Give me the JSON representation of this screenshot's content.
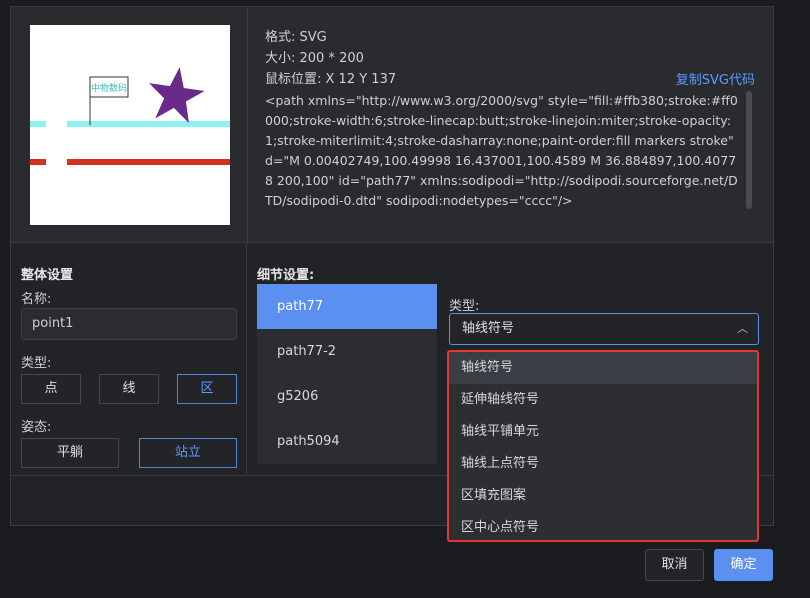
{
  "preview": {
    "flag_text": "中物数码",
    "colors": {
      "cyan_line": "#8ef2f2",
      "red_line": "#d2321f",
      "star": "#6a2a8a"
    }
  },
  "info": {
    "format": "格式: SVG",
    "size": "大小: 200 * 200",
    "mouse": "鼠标位置: X 12 Y 137",
    "copy_label": "复制SVG代码",
    "code": "<path xmlns=\"http://www.w3.org/2000/svg\" style=\"fill:#ffb380;stroke:#ff0000;stroke-width:6;stroke-linecap:butt;stroke-linejoin:miter;stroke-opacity:1;stroke-miterlimit:4;stroke-dasharray:none;paint-order:fill markers stroke\" d=\"M 0.00402749,100.49998 16.437001,100.4589 M 36.884897,100.40778 200,100\" id=\"path77\" xmlns:sodipodi=\"http://sodipodi.sourceforge.net/DTD/sodipodi-0.dtd\" sodipodi:nodetypes=\"cccc\"/>"
  },
  "overall": {
    "title": "整体设置",
    "name_label": "名称:",
    "name_value": "point1",
    "type_label": "类型:",
    "type_options": [
      "点",
      "线",
      "区"
    ],
    "pose_label": "姿态:",
    "pose_options": [
      "平躺",
      "站立"
    ]
  },
  "detail": {
    "title": "细节设置:",
    "items": [
      "path77",
      "path77-2",
      "g5206",
      "path5094"
    ],
    "type_label": "类型:",
    "type_value": "轴线符号",
    "dropdown_options": [
      "轴线符号",
      "延伸轴线符号",
      "轴线平铺单元",
      "轴线上点符号",
      "区填充图案",
      "区中心点符号"
    ]
  },
  "footer": {
    "cancel": "取消",
    "ok": "确定"
  },
  "accent": "#5b8ff0",
  "highlight_border": "#e0392b"
}
